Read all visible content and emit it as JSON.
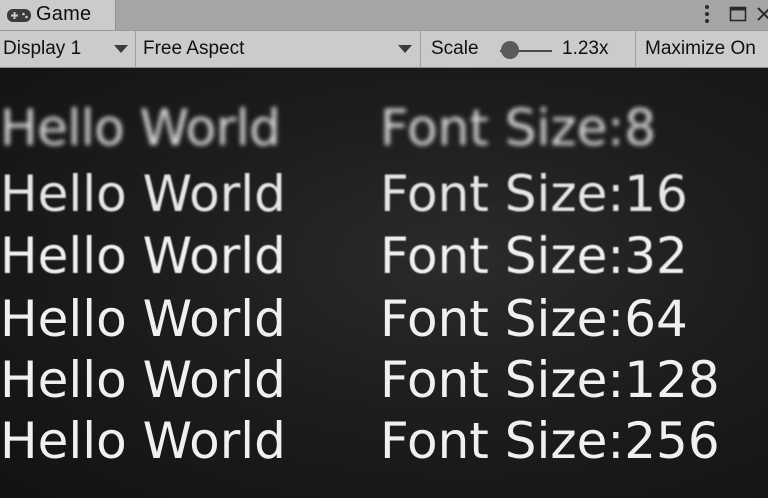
{
  "tab": {
    "title": "Game",
    "icon": "gamepad-icon"
  },
  "window_controls": {
    "menu_icon": "kebab-menu-icon",
    "maximize_icon": "maximize-icon",
    "close_icon": "close-icon"
  },
  "toolbar": {
    "display": "Display 1",
    "aspect": "Free Aspect",
    "scale_label": "Scale",
    "scale_value": "1.23x",
    "scale_level": 1.23,
    "maximize_label": "Maximize On"
  },
  "game_view": {
    "rows": [
      {
        "text": "Hello World",
        "label": "Font Size:8"
      },
      {
        "text": "Hello World",
        "label": "Font Size:16"
      },
      {
        "text": "Hello World",
        "label": "Font Size:32"
      },
      {
        "text": "Hello World",
        "label": "Font Size:64"
      },
      {
        "text": "Hello World",
        "label": "Font Size:128"
      },
      {
        "text": "Hello World",
        "label": "Font Size:256"
      }
    ]
  },
  "colors": {
    "toolbar_bg": "#cbcbcb",
    "tab_strip_bg": "#a5a5a5",
    "viewport_bg": "#1d1d1d",
    "text_color": "#f0f0f0"
  }
}
